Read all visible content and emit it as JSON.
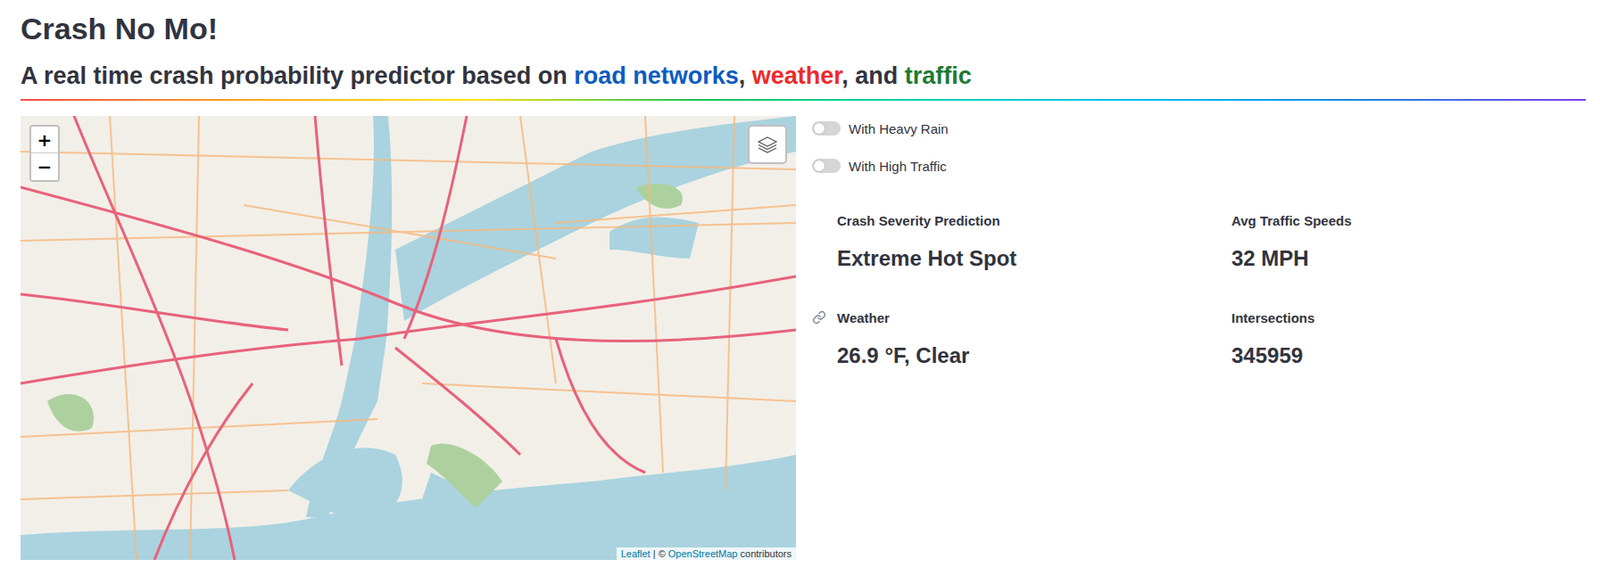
{
  "app": {
    "title": "Crash No Mo!",
    "subtitle": [
      {
        "text": "A real time crash probability predictor based on ",
        "color": "#31333f"
      },
      {
        "text": "road networks",
        "color": "#0b5cc2"
      },
      {
        "text": ", ",
        "color": "#31333f"
      },
      {
        "text": "weather",
        "color": "#ee2a2a"
      },
      {
        "text": ", and ",
        "color": "#31333f"
      },
      {
        "text": "traffic",
        "color": "#1e7a35"
      }
    ]
  },
  "map": {
    "zoom_buttons": [
      "+",
      "−"
    ],
    "attribution": [
      {
        "text": "Leaflet",
        "link": true
      },
      {
        "text": " | © ",
        "link": false
      },
      {
        "text": "OpenStreetMap",
        "link": true
      },
      {
        "text": " contributors",
        "link": false
      }
    ]
  },
  "toggles": [
    {
      "label": "With Heavy Rain",
      "on": false
    },
    {
      "label": "With High Traffic",
      "on": false
    }
  ],
  "metrics": [
    {
      "label": "Crash Severity Prediction",
      "value": "Extreme Hot Spot",
      "link_icon": false
    },
    {
      "label": "Avg Traffic Speeds",
      "value": "32 MPH",
      "link_icon": false
    },
    {
      "label": "Weather",
      "value": "26.9 °F, Clear",
      "link_icon": true
    },
    {
      "label": "Intersections",
      "value": "345959",
      "link_icon": false
    }
  ]
}
